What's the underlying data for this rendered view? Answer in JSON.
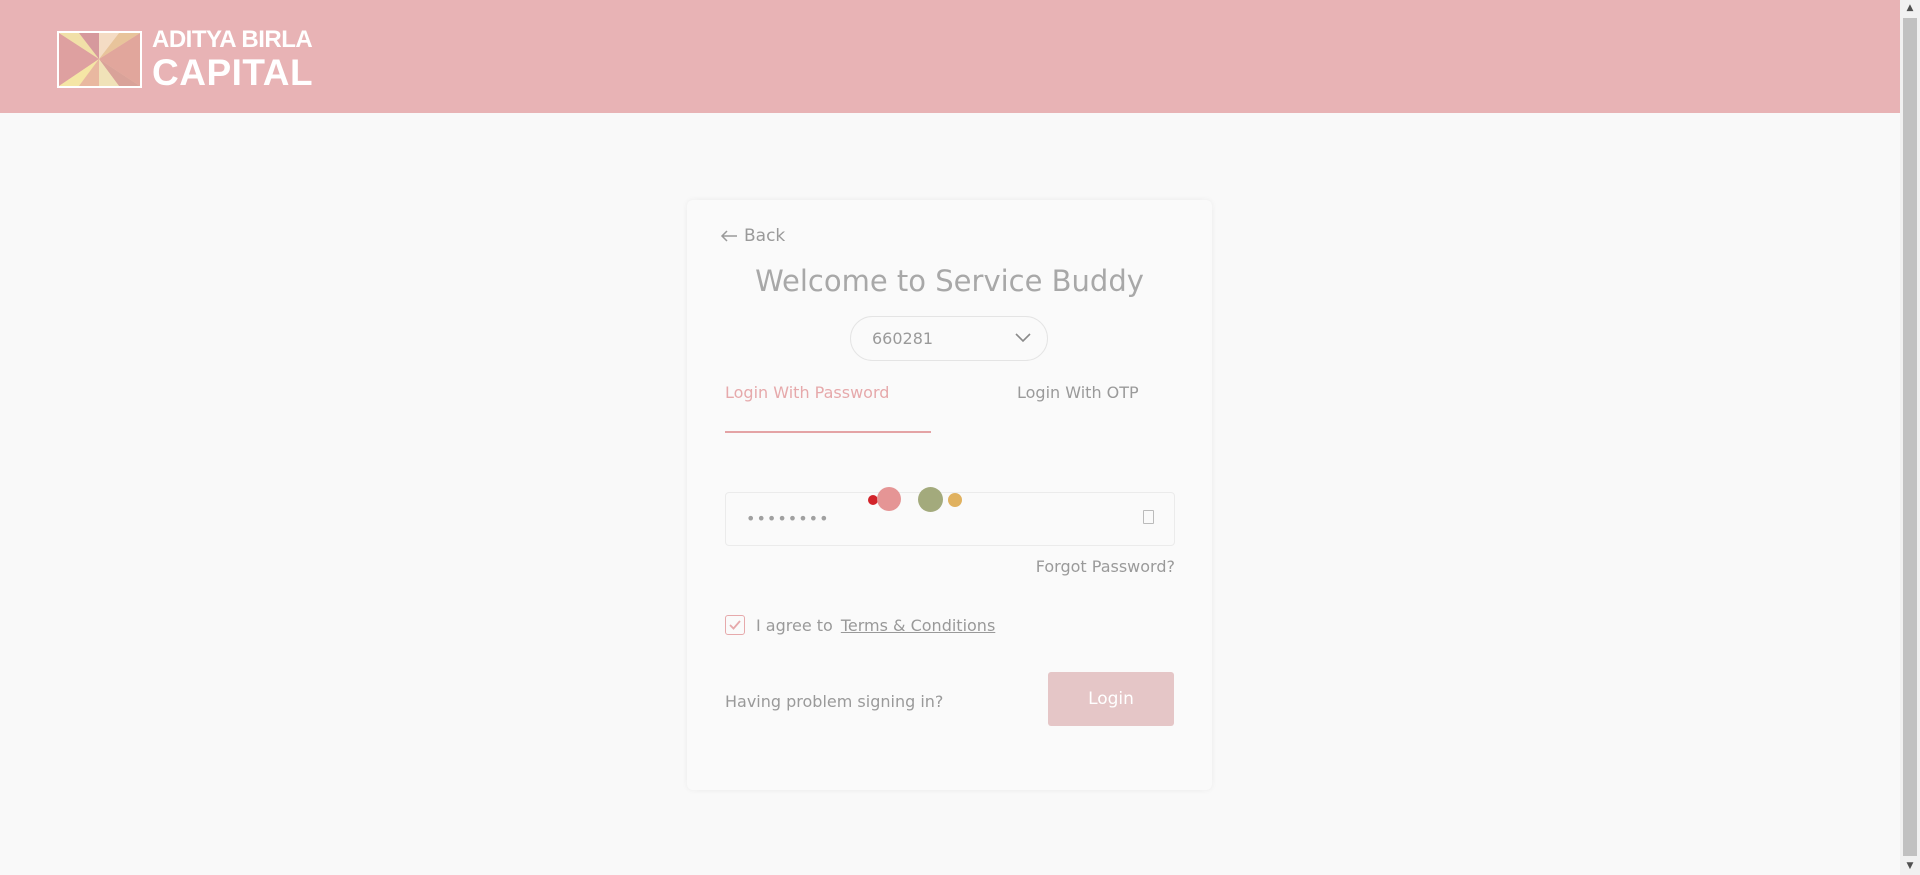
{
  "header": {
    "logo_line1": "ADITYA BIRLA",
    "logo_line2": "CAPITAL",
    "background_color": "#e8b3b5"
  },
  "card": {
    "back_label": "Back",
    "title": "Welcome to Service Buddy",
    "selected_code": "660281",
    "tabs": [
      {
        "label": "Login With Password",
        "active": true
      },
      {
        "label": "Login With OTP",
        "active": false
      }
    ],
    "password_value": "••••••••",
    "forgot_label": "Forgot Password?",
    "agree_text": "I agree to",
    "terms_label": "Terms & Conditions",
    "terms_checked": true,
    "problem_label": "Having problem signing in?",
    "login_label": "Login"
  },
  "colors": {
    "accent": "#e6a9ab",
    "login_button": "#e5c6c7",
    "loader_dots": [
      "#d2232a",
      "#e59595",
      "#a3aa7c",
      "#e0b15f"
    ]
  }
}
